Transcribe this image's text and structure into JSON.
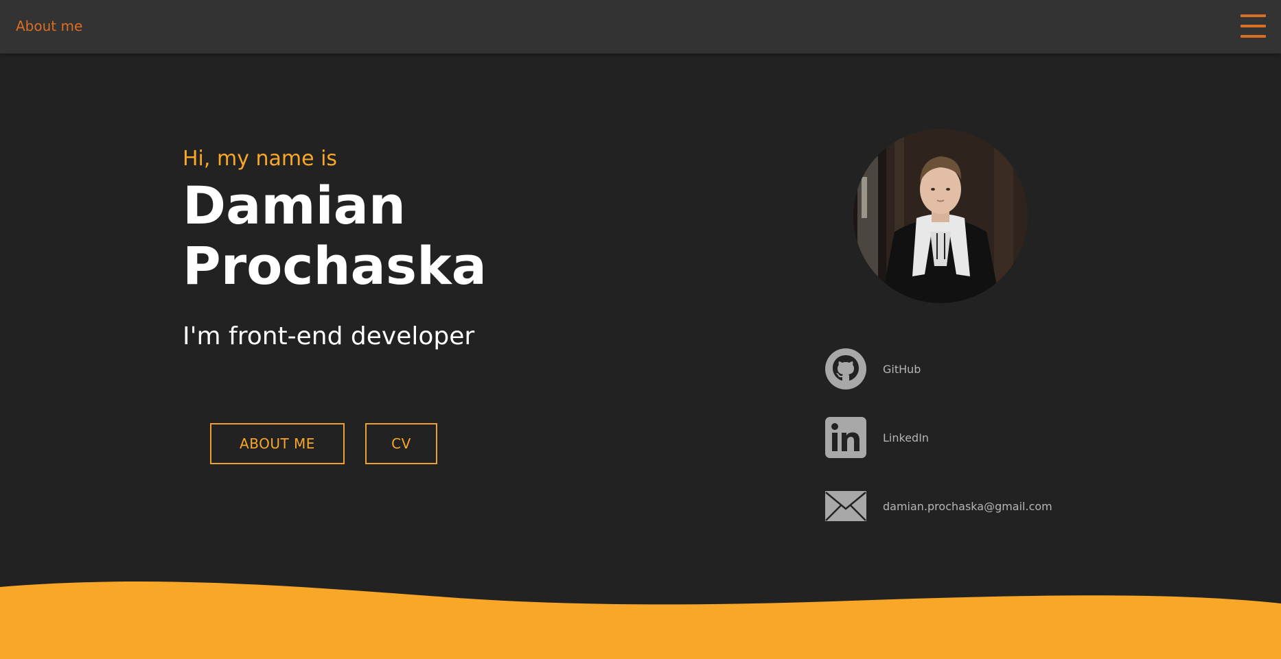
{
  "nav": {
    "brand": "About me",
    "menu_icon": "hamburger-menu-icon"
  },
  "hero": {
    "greeting": "Hi, my name is",
    "name": "Damian Prochaska",
    "role": "I'm front-end developer",
    "buttons": {
      "about_label": "ABOUT ME",
      "cv_label": "CV"
    }
  },
  "profile": {
    "avatar_alt": "profile-photo"
  },
  "contacts": [
    {
      "icon": "github-icon",
      "label": "GitHub"
    },
    {
      "icon": "linkedin-icon",
      "label": "LinkedIn"
    },
    {
      "icon": "mail-icon",
      "label": "damian.prochaska@gmail.com"
    }
  ],
  "colors": {
    "background": "#222222",
    "topbar": "#333333",
    "accent": "#f9a729",
    "accent_dark": "#d96e25",
    "contact_icon": "#a8a8a8",
    "wave": "#f9a729"
  }
}
